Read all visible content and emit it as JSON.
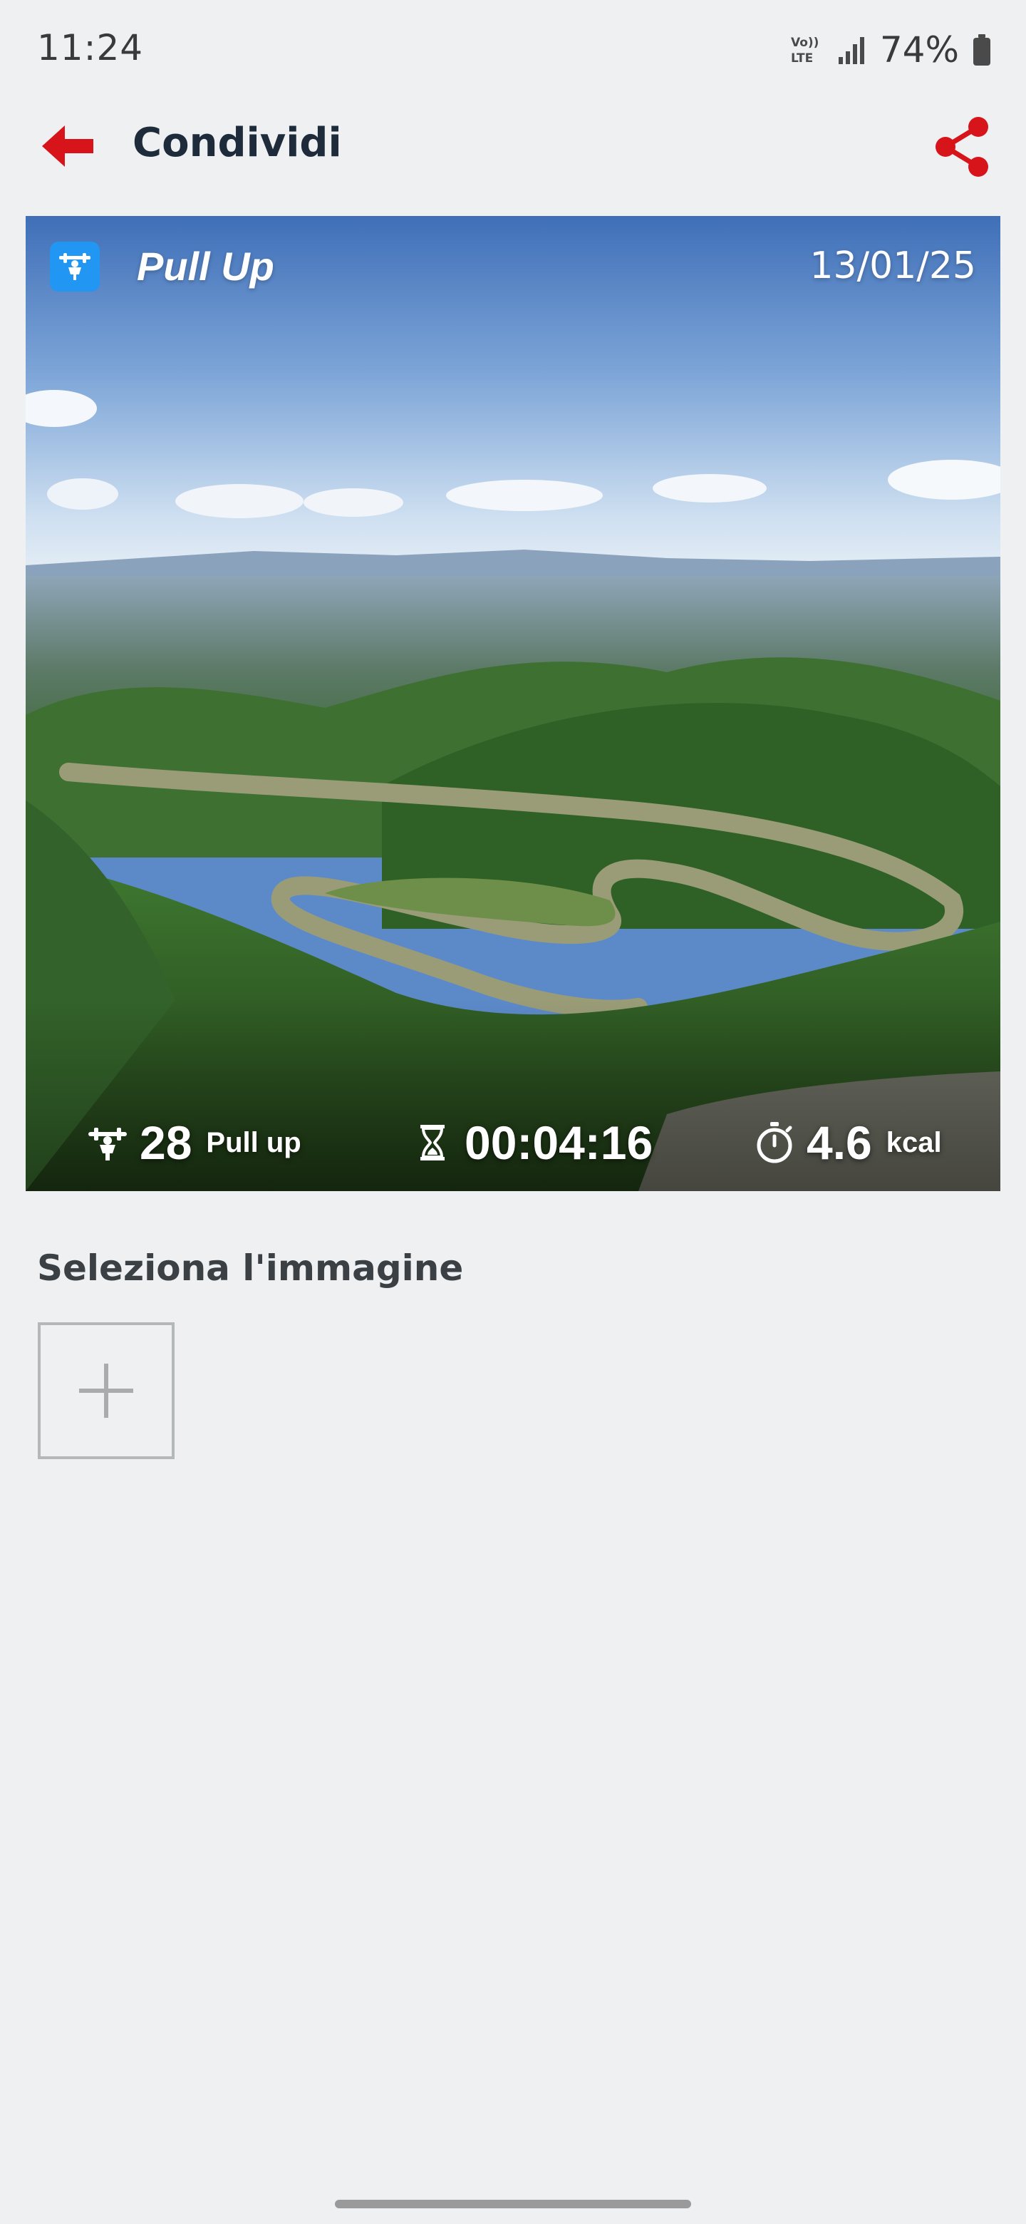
{
  "status_bar": {
    "time": "11:24",
    "network_icon": "volte-icon",
    "signal_icon": "signal-icon",
    "battery_percent": "74%",
    "battery_icon": "battery-icon"
  },
  "app_bar": {
    "title": "Condividi",
    "back_icon": "arrow-left-icon",
    "share_icon": "share-icon",
    "accent_color": "#d7141a"
  },
  "share_card": {
    "activity_icon": "pull-up-icon",
    "activity_name": "Pull Up",
    "date": "13/01/25",
    "background": "river-valley-landscape",
    "stats": {
      "reps_value": "28",
      "reps_unit": "Pull up",
      "reps_icon": "pull-up-icon",
      "duration_value": "00:04:16",
      "duration_icon": "hourglass-icon",
      "calories_value": "4.6",
      "calories_unit": "kcal",
      "calories_icon": "stopwatch-icon"
    }
  },
  "image_picker": {
    "label": "Seleziona l'immagine",
    "add_icon": "plus-icon"
  }
}
